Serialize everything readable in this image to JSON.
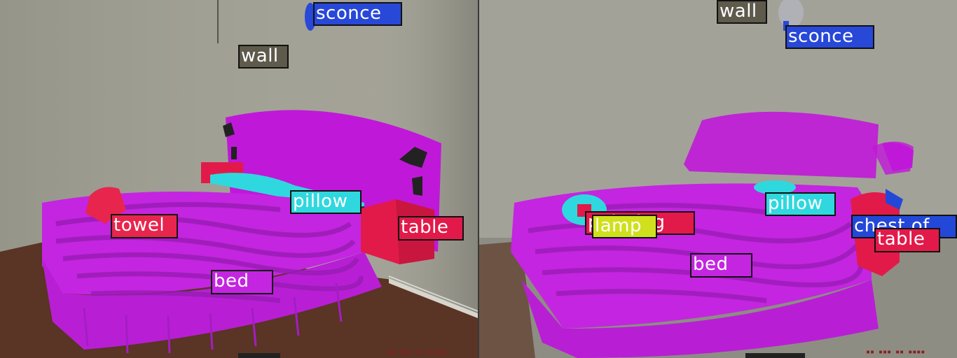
{
  "colors": {
    "wall": "#9e9d90",
    "floor": "#5a3424",
    "bed": "#c425e0",
    "bed_stripes": "#9a1cb6",
    "headboard": "#c018d8",
    "pillow": "#2fd8de",
    "table": "#e21a4a",
    "towel": "#e8254d",
    "sconce": "#2848d8",
    "lamp": "#d0e01c",
    "chest": "#2348d8"
  },
  "left_panel": {
    "labels": {
      "sconce": "sconce",
      "wall": "wall",
      "pillow": "pillow",
      "towel": "towel",
      "table": "table",
      "bed": "bed"
    }
  },
  "right_panel": {
    "labels": {
      "wall": "wall",
      "sconce": "sconce",
      "pillow": "pillow",
      "painting": "painting",
      "lamp": "lamp",
      "chest": "chest of",
      "table": "table",
      "bed": "bed"
    }
  }
}
